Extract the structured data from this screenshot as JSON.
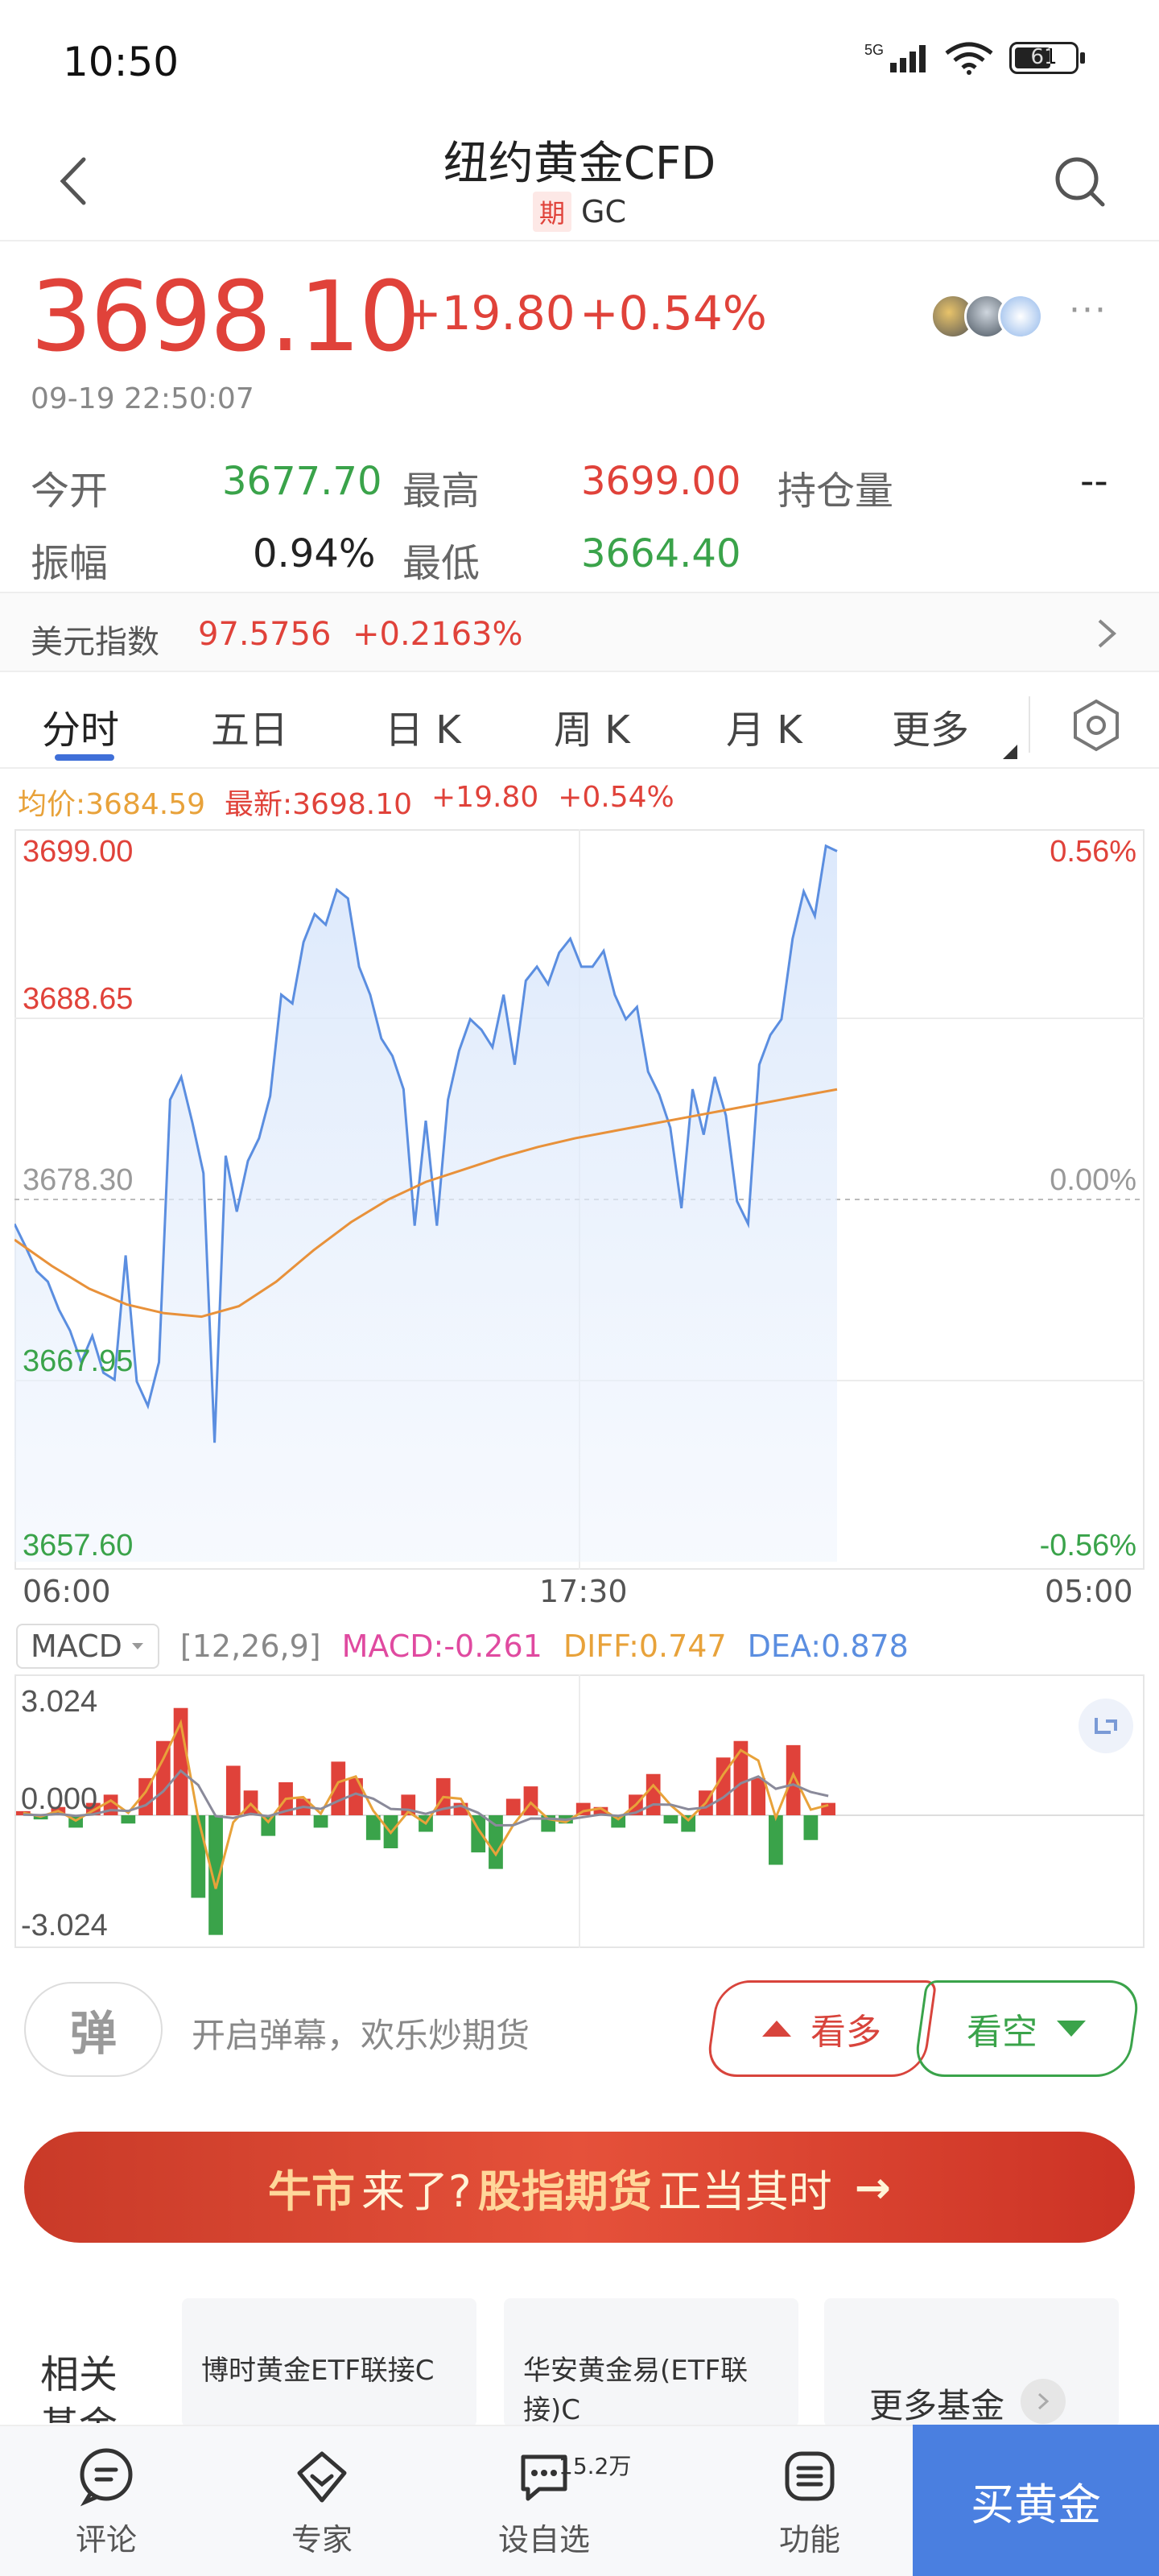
{
  "status_bar": {
    "time": "10:50",
    "network": "5G",
    "battery": "61"
  },
  "header": {
    "title": "纽约黄金CFD",
    "badge": "期",
    "code": "GC"
  },
  "quote": {
    "price": "3698.10",
    "change": "+19.80",
    "change_pct": "+0.54%",
    "timestamp": "09-19 22:50:07"
  },
  "stats": {
    "open_label": "今开",
    "open": "3677.70",
    "high_label": "最高",
    "high": "3699.00",
    "oi_label": "持仓量",
    "oi": "--",
    "amp_label": "振幅",
    "amp": "0.94%",
    "low_label": "最低",
    "low": "3664.40"
  },
  "usd_index": {
    "label": "美元指数",
    "value": "97.5756",
    "change": "+0.2163%"
  },
  "tabs": [
    "分时",
    "五日",
    "日 K",
    "周 K",
    "月 K",
    "更多"
  ],
  "legend": {
    "avg": "均价:3684.59",
    "latest": "最新:3698.10",
    "chg": "+19.80",
    "pct": "+0.54%"
  },
  "chart_data": [
    {
      "type": "line",
      "x_ticks": [
        "06:00",
        "17:30",
        "05:00"
      ],
      "y_ticks_left": [
        "3699.00",
        "3688.65",
        "3678.30",
        "3667.95",
        "3657.60"
      ],
      "y_ticks_right": [
        "0.56%",
        "0.00%",
        "-0.56%"
      ],
      "ylim": [
        3657.6,
        3699.0
      ],
      "grid": true,
      "series": [
        {
          "name": "最新",
          "color": "#5b8ee0",
          "values": [
            3676.9,
            3675.6,
            3674.2,
            3673.6,
            3672.0,
            3670.8,
            3669.0,
            3670.5,
            3668.4,
            3668.0,
            3675.1,
            3667.9,
            3666.5,
            3669.0,
            3684.0,
            3685.3,
            3682.7,
            3679.8,
            3664.4,
            3680.8,
            3677.6,
            3680.5,
            3681.8,
            3684.2,
            3690.0,
            3689.5,
            3693.0,
            3694.6,
            3694.0,
            3696.0,
            3695.5,
            3691.6,
            3690.0,
            3687.5,
            3686.5,
            3684.6,
            3676.8,
            3682.8,
            3676.8,
            3684.0,
            3686.8,
            3688.6,
            3688.0,
            3687.0,
            3690.0,
            3686.0,
            3690.8,
            3691.6,
            3690.6,
            3692.4,
            3693.2,
            3691.6,
            3691.6,
            3692.5,
            3690.0,
            3688.6,
            3689.3,
            3685.6,
            3684.3,
            3682.4,
            3677.8,
            3684.6,
            3682.0,
            3685.3,
            3683.1,
            3678.2,
            3676.9,
            3686.0,
            3687.7,
            3688.6,
            3693.2,
            3695.9,
            3694.5,
            3698.5,
            3698.2
          ]
        },
        {
          "name": "均价",
          "color": "#e8913a",
          "values": [
            3676.0,
            3674.5,
            3673.2,
            3672.3,
            3671.8,
            3671.6,
            3672.2,
            3673.6,
            3675.4,
            3677.0,
            3678.3,
            3679.3,
            3680.0,
            3680.7,
            3681.3,
            3681.8,
            3682.2,
            3682.6,
            3683.0,
            3683.4,
            3683.8,
            3684.2,
            3684.59
          ]
        }
      ]
    },
    {
      "type": "bar",
      "title": "MACD",
      "params": "[12,26,9]",
      "ylim": [
        -3.024,
        3.024
      ],
      "y_ticks": [
        "3.024",
        "0.000",
        "-3.024"
      ],
      "series": [
        {
          "name": "MACD",
          "value": -0.261,
          "color": "#e04aa0"
        },
        {
          "name": "DIFF",
          "value": 0.747,
          "color": "#e8a23a"
        },
        {
          "name": "DEA",
          "value": 0.878,
          "color": "#5b8ee0"
        }
      ],
      "histogram": [
        0.1,
        -0.1,
        0.2,
        -0.3,
        0.3,
        0.5,
        -0.2,
        0.9,
        1.8,
        2.6,
        -2.0,
        -2.9,
        1.2,
        0.6,
        -0.5,
        0.8,
        0.4,
        -0.3,
        1.3,
        0.9,
        -0.6,
        -0.8,
        0.5,
        -0.4,
        0.9,
        0.3,
        -0.9,
        -1.3,
        0.4,
        0.7,
        -0.4,
        -0.2,
        0.3,
        0.2,
        -0.3,
        0.5,
        1.0,
        -0.2,
        -0.4,
        0.6,
        1.4,
        1.8,
        0.9,
        -1.2,
        1.7,
        -0.6,
        0.3
      ],
      "labels": {
        "macd": "MACD:-0.261",
        "diff": "DIFF:0.747",
        "dea": "DEA:0.878"
      }
    }
  ],
  "barrage": {
    "icon": "弹",
    "placeholder": "开启弹幕，欢乐炒期货",
    "bull": "看多",
    "bear": "看空"
  },
  "banner": {
    "part1": "牛市",
    "part2": "来了?",
    "part3": "股指期货",
    "part4": "正当其时",
    "arrow": "→"
  },
  "related": {
    "label": "相关基金",
    "funds": [
      "博时黄金ETF联接C",
      "华安黄金易(ETF联接)C"
    ],
    "more": "更多基金"
  },
  "bottom_nav": {
    "items": [
      "评论",
      "专家",
      "设自选",
      "功能"
    ],
    "badge": "15.2万",
    "buy": "买黄金"
  }
}
